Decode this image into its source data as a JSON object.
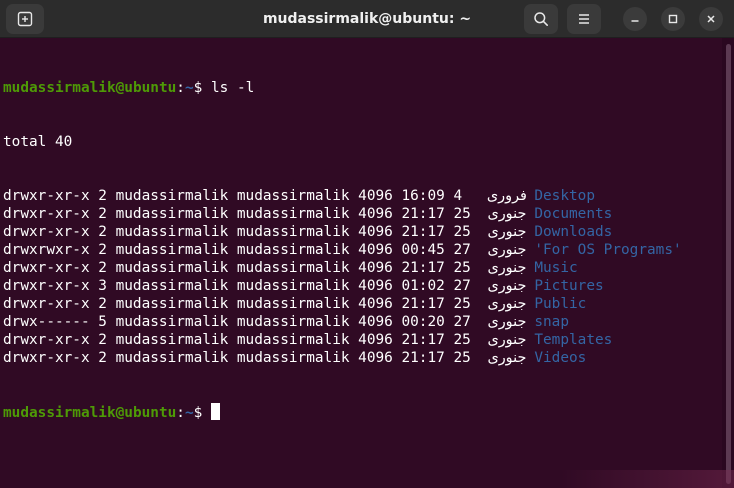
{
  "window": {
    "title": "mudassirmalik@ubuntu: ~"
  },
  "icons": {
    "new_tab": "new-tab-icon",
    "search": "search-icon",
    "menu": "hamburger-menu-icon",
    "minimize": "minimize-icon",
    "maximize": "maximize-icon",
    "close": "close-icon"
  },
  "colors": {
    "background": "#300a24",
    "prompt_user": "#4e9a06",
    "directory": "#3465a4",
    "text": "#ffffff"
  },
  "prompt": {
    "user_host": "mudassirmalik@ubuntu",
    "sep": ":",
    "path": "~",
    "symbol": "$ "
  },
  "command": "ls -l",
  "total": "total 40",
  "listing": [
    {
      "perms": "drwxr-xr-x",
      "links": "2",
      "owner": "mudassirmalik",
      "group": "mudassirmalik",
      "size": "4096",
      "time": "16:09",
      "day": "4",
      "month": "فروری",
      "name": "Desktop"
    },
    {
      "perms": "drwxr-xr-x",
      "links": "2",
      "owner": "mudassirmalik",
      "group": "mudassirmalik",
      "size": "4096",
      "time": "21:17",
      "day": "25",
      "month": "جنوری",
      "name": "Documents"
    },
    {
      "perms": "drwxr-xr-x",
      "links": "2",
      "owner": "mudassirmalik",
      "group": "mudassirmalik",
      "size": "4096",
      "time": "21:17",
      "day": "25",
      "month": "جنوری",
      "name": "Downloads"
    },
    {
      "perms": "drwxrwxr-x",
      "links": "2",
      "owner": "mudassirmalik",
      "group": "mudassirmalik",
      "size": "4096",
      "time": "00:45",
      "day": "27",
      "month": "جنوری",
      "name": "'For OS Programs'"
    },
    {
      "perms": "drwxr-xr-x",
      "links": "2",
      "owner": "mudassirmalik",
      "group": "mudassirmalik",
      "size": "4096",
      "time": "21:17",
      "day": "25",
      "month": "جنوری",
      "name": "Music"
    },
    {
      "perms": "drwxr-xr-x",
      "links": "3",
      "owner": "mudassirmalik",
      "group": "mudassirmalik",
      "size": "4096",
      "time": "01:02",
      "day": "27",
      "month": "جنوری",
      "name": "Pictures"
    },
    {
      "perms": "drwxr-xr-x",
      "links": "2",
      "owner": "mudassirmalik",
      "group": "mudassirmalik",
      "size": "4096",
      "time": "21:17",
      "day": "25",
      "month": "جنوری",
      "name": "Public"
    },
    {
      "perms": "drwx------",
      "links": "5",
      "owner": "mudassirmalik",
      "group": "mudassirmalik",
      "size": "4096",
      "time": "00:20",
      "day": "27",
      "month": "جنوری",
      "name": "snap"
    },
    {
      "perms": "drwxr-xr-x",
      "links": "2",
      "owner": "mudassirmalik",
      "group": "mudassirmalik",
      "size": "4096",
      "time": "21:17",
      "day": "25",
      "month": "جنوری",
      "name": "Templates"
    },
    {
      "perms": "drwxr-xr-x",
      "links": "2",
      "owner": "mudassirmalik",
      "group": "mudassirmalik",
      "size": "4096",
      "time": "21:17",
      "day": "25",
      "month": "جنوری",
      "name": "Videos"
    }
  ]
}
